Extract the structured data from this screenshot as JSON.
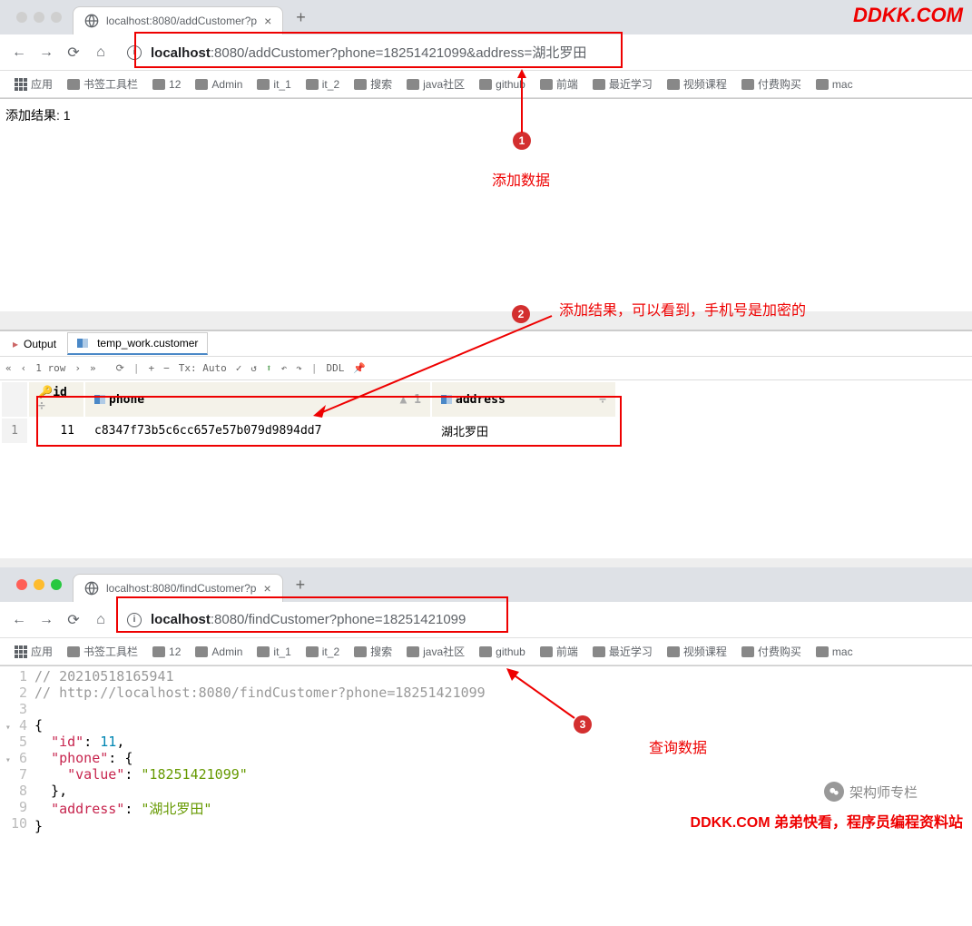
{
  "watermark_top": "DDKK.COM",
  "watermark_bottom": "DDKK.COM 弟弟快看，程序员编程资料站",
  "wechat_label": "架构师专栏",
  "browser1": {
    "tab_title": "localhost:8080/addCustomer?p",
    "url_host": "localhost",
    "url_path": ":8080/addCustomer?phone=18251421099&address=湖北罗田",
    "page_result": "添加结果: 1"
  },
  "bookmarks": [
    "应用",
    "书签工具栏",
    "12",
    "Admin",
    "it_1",
    "it_2",
    "搜索",
    "java社区",
    "github",
    "前端",
    "最近学习",
    "视频课程",
    "付费购买",
    "mac"
  ],
  "annotations": {
    "n1": "1",
    "t1": "添加数据",
    "n2": "2",
    "t2": "添加结果，可以看到，手机号是加密的",
    "n3": "3",
    "t3": "查询数据"
  },
  "ide": {
    "tab_output": "Output",
    "tab_table": "temp_work.customer",
    "rowcount": "1 row",
    "txmode": "Tx: Auto",
    "ddl": "DDL",
    "cols": {
      "id": "id",
      "phone": "phone",
      "address": "address",
      "sort": "1"
    },
    "row": {
      "n": "1",
      "id": "11",
      "phone": "c8347f73b5c6cc657e57b079d9894dd7",
      "address": "湖北罗田"
    }
  },
  "browser2": {
    "tab_title": "localhost:8080/findCustomer?p",
    "url_host": "localhost",
    "url_path": ":8080/findCustomer?phone=18251421099"
  },
  "code": {
    "l1": "// 20210518165941",
    "l2": "// http://localhost:8080/findCustomer?phone=18251421099",
    "id_key": "\"id\"",
    "id_val": "11",
    "phone_key": "\"phone\"",
    "value_key": "\"value\"",
    "value_val": "\"18251421099\"",
    "addr_key": "\"address\"",
    "addr_val": "\"湖北罗田\""
  }
}
